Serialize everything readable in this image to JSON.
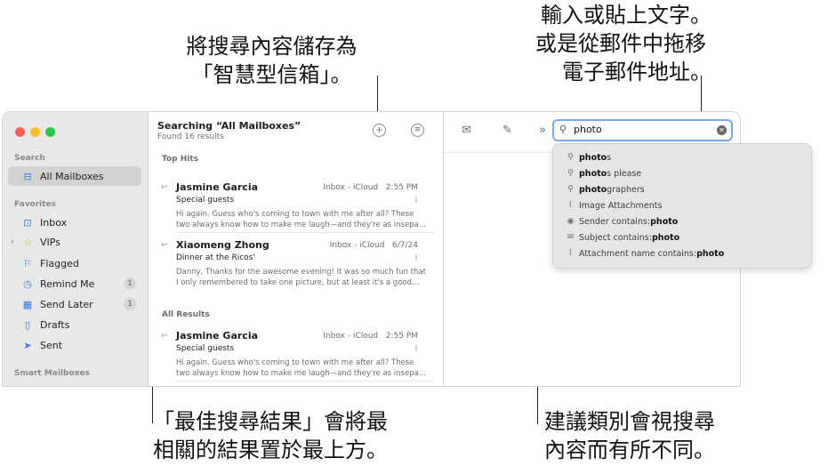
{
  "callouts": {
    "save": [
      "將搜尋內容儲存為",
      "「智慧型信箱」。"
    ],
    "input": [
      "輸入或貼上文字。",
      "或是從郵件中拖移",
      "電子郵件地址。"
    ],
    "tophits": [
      "「最佳搜尋結果」會將最",
      "相關的結果置於最上方。"
    ],
    "suggestions": [
      "建議類別會視搜尋",
      "內容而有所不同。"
    ]
  },
  "sidebar": {
    "search_section": "Search",
    "all_mailboxes": "All Mailboxes",
    "favorites_section": "Favorites",
    "items": [
      {
        "label": "Inbox",
        "icon": "inbox-icon",
        "glyph": "⊡"
      },
      {
        "label": "VIPs",
        "icon": "star-icon",
        "glyph": "☆"
      },
      {
        "label": "Flagged",
        "icon": "flag-icon",
        "glyph": "⚐"
      },
      {
        "label": "Remind Me",
        "icon": "clock-icon",
        "glyph": "◷",
        "count": "1"
      },
      {
        "label": "Send Later",
        "icon": "calendar-icon",
        "glyph": "▦",
        "count": "1"
      },
      {
        "label": "Drafts",
        "icon": "document-icon",
        "glyph": "▯"
      },
      {
        "label": "Sent",
        "icon": "paperplane-icon",
        "glyph": "➤"
      }
    ],
    "smart_section": "Smart Mailboxes"
  },
  "list": {
    "title": "Searching “All Mailboxes”",
    "subtitle": "Found 16 results",
    "top_hits_label": "Top Hits",
    "all_results_label": "All Results",
    "messages": [
      {
        "sender": "Jasmine Garcia",
        "mailbox": "Inbox - iCloud",
        "time": "2:55 PM",
        "subject": "Special guests",
        "preview": "Hi again. Guess who's coming to town with me after all? These two always know how to make me laugh—and they're as insepa..."
      },
      {
        "sender": "Xiaomeng Zhong",
        "mailbox": "Inbox - iCloud",
        "time": "6/7/24",
        "subject": "Dinner at the Ricos'",
        "preview": "Danny, Thanks for the awesome evening! It was so much fun that I only remembered to take one picture, but at least it's a good..."
      },
      {
        "sender": "Jasmine Garcia",
        "mailbox": "Inbox - iCloud",
        "time": "2:55 PM",
        "subject": "Special guests",
        "preview": "Hi again. Guess who's coming to town with me after all? These two always know how to make me laugh—and they're as insepa..."
      }
    ]
  },
  "search": {
    "value": "photo",
    "suggestions": [
      {
        "icon": "magnifier-icon",
        "glyph": "⚲",
        "bold": "photo",
        "rest": "s"
      },
      {
        "icon": "magnifier-icon",
        "glyph": "⚲",
        "bold": "photo",
        "rest": "s please"
      },
      {
        "icon": "magnifier-icon",
        "glyph": "⚲",
        "bold": "photo",
        "rest": "graphers"
      },
      {
        "icon": "paperclip-icon",
        "glyph": "⌇",
        "bold": "",
        "rest": "Image Attachments"
      },
      {
        "icon": "person-icon",
        "glyph": "◉",
        "bold": "",
        "rest": "Sender contains: ",
        "tail": "photo"
      },
      {
        "icon": "envelope-icon",
        "glyph": "✉",
        "bold": "",
        "rest": "Subject contains: ",
        "tail": "photo"
      },
      {
        "icon": "paperclip-icon",
        "glyph": "⌇",
        "bold": "",
        "rest": "Attachment name contains: ",
        "tail": "photo"
      }
    ]
  },
  "colors": {
    "accent": "#3478f6",
    "close": "#ff5f57",
    "minimize": "#febc2e",
    "zoom": "#28c840"
  }
}
